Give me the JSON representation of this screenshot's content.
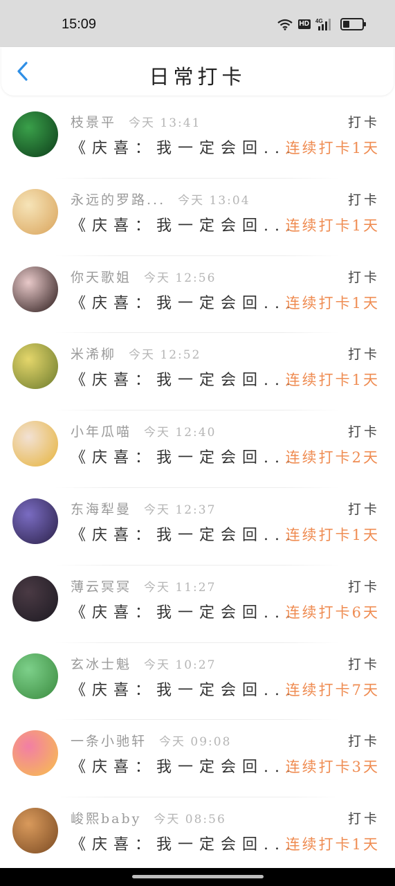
{
  "status_bar": {
    "time": "15:09",
    "hd_label": "HD",
    "network_label": "4G",
    "battery_level": 0.35
  },
  "header": {
    "title": "日常打卡",
    "back_icon": "chevron-left-icon",
    "accent_color": "#2f8fe6"
  },
  "checkins": [
    {
      "username": "枝景平",
      "time": "今天 13:41",
      "action": "打卡",
      "content": "《庆喜：我一定会回...",
      "streak": "连续打卡1天",
      "avatar_colors": [
        "#3aa04a",
        "#0d3d1a"
      ]
    },
    {
      "username": "永远的罗路...",
      "time": "今天 13:04",
      "action": "打卡",
      "content": "《庆喜：我一定会回...",
      "streak": "连续打卡1天",
      "avatar_colors": [
        "#f6e4b8",
        "#d9a35a"
      ]
    },
    {
      "username": "你天歌姐",
      "time": "今天 12:56",
      "action": "打卡",
      "content": "《庆喜：我一定会回...",
      "streak": "连续打卡1天",
      "avatar_colors": [
        "#e8c9c9",
        "#2a1a1a"
      ]
    },
    {
      "username": "米浠柳",
      "time": "今天 12:52",
      "action": "打卡",
      "content": "《庆喜：我一定会回...",
      "streak": "连续打卡1天",
      "avatar_colors": [
        "#e4d66b",
        "#6b7a2c"
      ]
    },
    {
      "username": "小年瓜喵",
      "time": "今天 12:40",
      "action": "打卡",
      "content": "《庆喜：我一定会回...",
      "streak": "连续打卡2天",
      "avatar_colors": [
        "#f2e1d4",
        "#e6b33a"
      ]
    },
    {
      "username": "东海犁曼",
      "time": "今天 12:37",
      "action": "打卡",
      "content": "《庆喜：我一定会回...",
      "streak": "连续打卡1天",
      "avatar_colors": [
        "#7a6cc2",
        "#2b2148"
      ]
    },
    {
      "username": "薄云冥冥",
      "time": "今天 11:27",
      "action": "打卡",
      "content": "《庆喜：我一定会回...",
      "streak": "连续打卡6天",
      "avatar_colors": [
        "#4a3a44",
        "#1d1a22"
      ]
    },
    {
      "username": "玄冰士魁",
      "time": "今天 10:27",
      "action": "打卡",
      "content": "《庆喜：我一定会回...",
      "streak": "连续打卡7天",
      "avatar_colors": [
        "#7dd08a",
        "#3a8a3e"
      ]
    },
    {
      "username": "一条小驰轩",
      "time": "今天 09:08",
      "action": "打卡",
      "content": "《庆喜：我一定会回...",
      "streak": "连续打卡3天",
      "avatar_colors": [
        "#f27ea5",
        "#f7c04a"
      ]
    },
    {
      "username": "峻熙baby",
      "time": "今天 08:56",
      "action": "打卡",
      "content": "《庆喜：我一定会回...",
      "streak": "连续打卡1天",
      "avatar_colors": [
        "#d99a5c",
        "#7a4a22"
      ]
    }
  ]
}
